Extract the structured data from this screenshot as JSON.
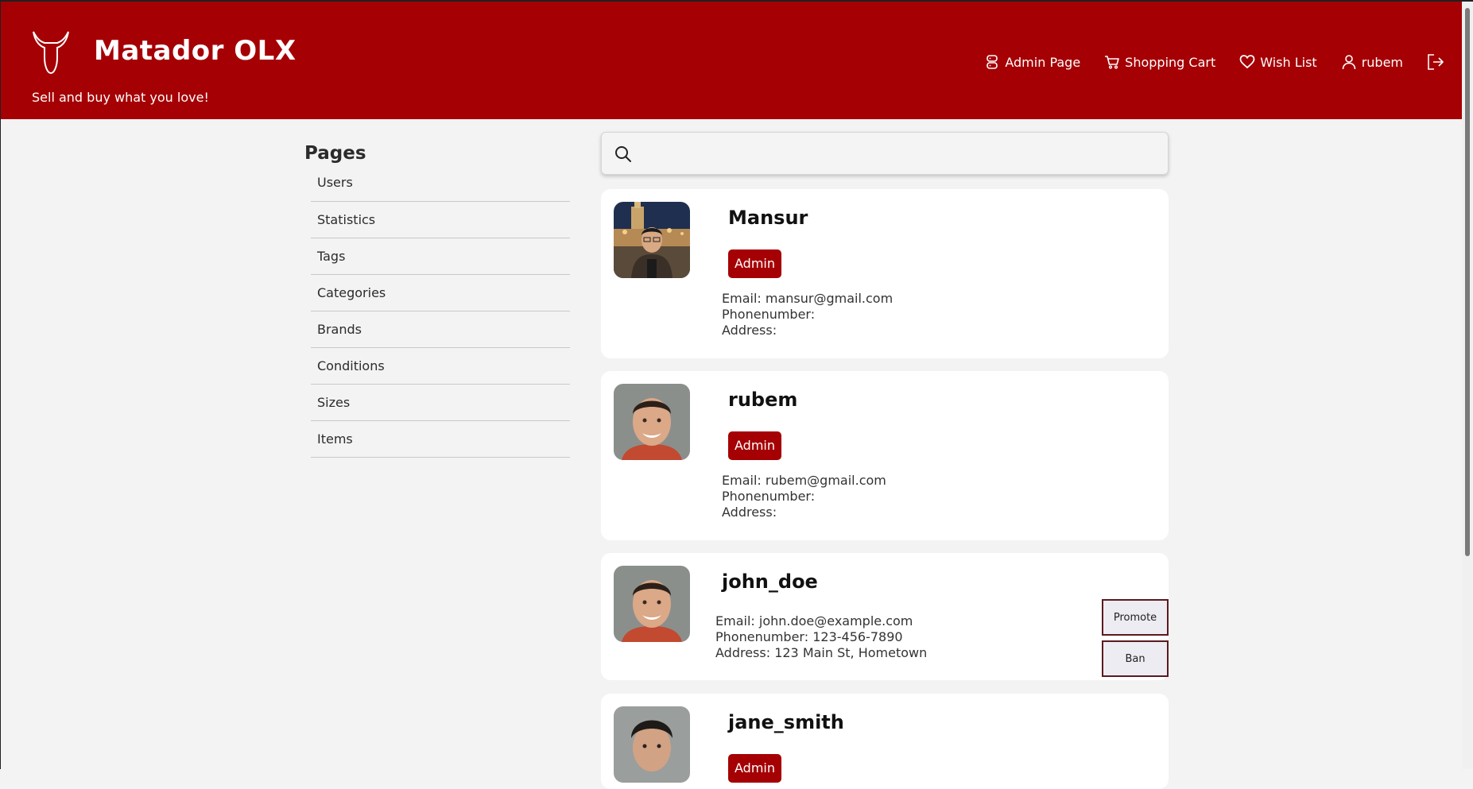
{
  "header": {
    "title": "Matador OLX",
    "tagline": "Sell and buy what you love!",
    "nav": {
      "admin_page": "Admin Page",
      "shopping_cart": "Shopping Cart",
      "wish_list": "Wish List",
      "user": "rubem"
    }
  },
  "sidebar": {
    "title": "Pages",
    "items": [
      {
        "label": "Users"
      },
      {
        "label": "Statistics"
      },
      {
        "label": "Tags"
      },
      {
        "label": "Categories"
      },
      {
        "label": "Brands"
      },
      {
        "label": "Conditions"
      },
      {
        "label": "Sizes"
      },
      {
        "label": "Items"
      }
    ]
  },
  "search": {
    "value": ""
  },
  "users": [
    {
      "name": "Mansur",
      "badge": "Admin",
      "email": "Email: mansur@gmail.com",
      "phone": "Phonenumber:",
      "address": "Address:"
    },
    {
      "name": "rubem",
      "badge": "Admin",
      "email": "Email: rubem@gmail.com",
      "phone": "Phonenumber:",
      "address": "Address:"
    },
    {
      "name": "john_doe",
      "email": "Email: john.doe@example.com",
      "phone": "Phonenumber: 123-456-7890",
      "address": "Address: 123 Main St, Hometown",
      "promote_label": "Promote",
      "ban_label": "Ban"
    },
    {
      "name": "jane_smith",
      "badge": "Admin"
    }
  ],
  "colors": {
    "brand": "#a50004",
    "background": "#f3f3f3",
    "card": "#ffffff"
  }
}
